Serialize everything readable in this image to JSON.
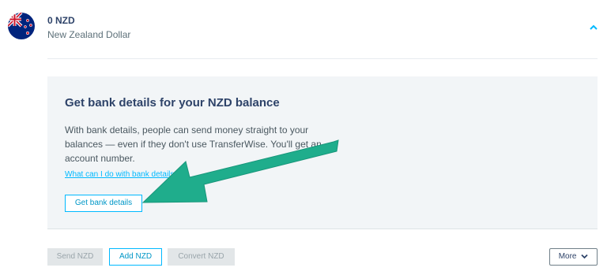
{
  "balance": {
    "amount": "0 NZD",
    "currency_name": "New Zealand Dollar",
    "flag_icon": "nz-flag-icon"
  },
  "panel": {
    "title": "Get bank details for your NZD balance",
    "body": "With bank details, people can send money straight to your balances — even if they don't use TransferWise. You'll get an account number.",
    "link": "What can I do with bank details?",
    "button": "Get bank details"
  },
  "actions": {
    "send": "Send NZD",
    "add": "Add NZD",
    "convert": "Convert NZD",
    "more": "More"
  },
  "colors": {
    "accent": "#00b9ff",
    "arrow": "#1fad8c",
    "panel_bg": "#f2f5f7"
  }
}
